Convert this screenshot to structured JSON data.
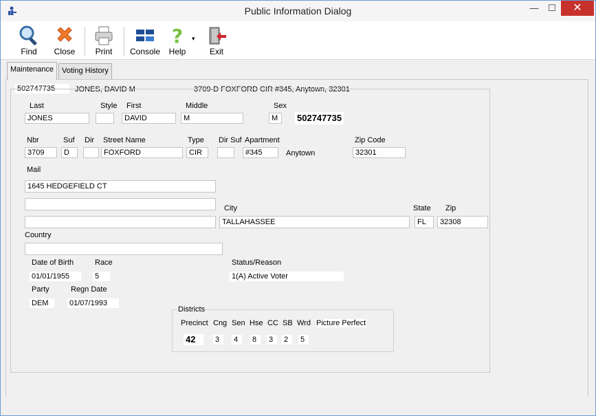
{
  "window": {
    "title": "Public Information Dialog",
    "minimize": "—",
    "maximize": "☐",
    "close": "✕"
  },
  "toolbar": {
    "find": "Find",
    "close": "Close",
    "print": "Print",
    "console": "Console",
    "help": "Help",
    "help_arrow": "▾",
    "exit": "Exit"
  },
  "tabs": {
    "maintenance": "Maintenance",
    "voting_history": "Voting History"
  },
  "header": {
    "voter_id": "502747735",
    "name": "JONES, DAVID M",
    "address": "3709-D FOXFORD CIR #345, Anytown, 32301"
  },
  "labels": {
    "last": "Last",
    "style": "Style",
    "first": "First",
    "middle": "Middle",
    "sex": "Sex",
    "nbr": "Nbr",
    "suf": "Suf",
    "dir": "Dir",
    "street_name": "Street Name",
    "type": "Type",
    "dir_suf": "Dir Suf",
    "apartment": "Apartment",
    "zip_code": "Zip Code",
    "mail": "Mail",
    "city": "City",
    "state": "State",
    "zip": "Zip",
    "country": "Country",
    "dob": "Date of Birth",
    "race": "Race",
    "status_reason": "Status/Reason",
    "party": "Party",
    "regn_date": "Regn Date",
    "districts": "Districts",
    "precinct": "Precinct",
    "cng": "Cng",
    "sen": "Sen",
    "hse": "Hse",
    "cc": "CC",
    "sb": "SB",
    "wrd": "Wrd",
    "picture_perfect": "Picture Perfect"
  },
  "values": {
    "last": "JONES",
    "style": "",
    "first": "DAVID",
    "middle": "M",
    "sex": "M",
    "voter_id_big": "502747735",
    "nbr": "3709",
    "suf": "D",
    "dir": "",
    "street_name": "FOXFORD",
    "type": "CIR",
    "dir_suf": "",
    "apartment": "#345",
    "city_name": "Anytown",
    "zip_code": "32301",
    "mail1": "1645 HEDGEFIELD CT",
    "mail2": "",
    "mail3": "",
    "city": "TALLAHASSEE",
    "state": "FL",
    "zip": "32308",
    "country": "",
    "dob": "01/01/1955",
    "race": "5",
    "status_reason": "1(A) Active Voter",
    "party": "DEM",
    "regn_date": "01/07/1993",
    "precinct": "42",
    "cng": "3",
    "sen": "4",
    "hse": "8",
    "cc": "3",
    "sb": "2",
    "wrd": "5"
  }
}
